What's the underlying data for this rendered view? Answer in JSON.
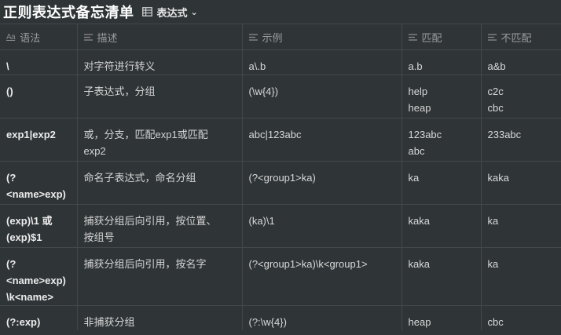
{
  "title": "正则表达式备忘清单",
  "view": {
    "label": "表达式",
    "icon": "table-icon",
    "chevron": "chevron-down-icon"
  },
  "columns": [
    {
      "label": "语法",
      "icon": "aa-title-icon"
    },
    {
      "label": "描述",
      "icon": "text-lines-icon"
    },
    {
      "label": "示例",
      "icon": "text-lines-icon"
    },
    {
      "label": "匹配",
      "icon": "text-lines-icon"
    },
    {
      "label": "不匹配",
      "icon": "text-lines-icon"
    }
  ],
  "rows": [
    {
      "syntax": [
        "\\"
      ],
      "desc": [
        "对字符进行转义"
      ],
      "example": [
        "a\\.b"
      ],
      "match": [
        "a.b"
      ],
      "nomatch": [
        "a&b"
      ]
    },
    {
      "syntax": [
        "()"
      ],
      "desc": [
        "子表达式，分组"
      ],
      "example": [
        "(\\w{4})"
      ],
      "match": [
        "help",
        "heap"
      ],
      "nomatch": [
        "c2c",
        "cbc"
      ]
    },
    {
      "syntax": [
        "exp1|exp2"
      ],
      "desc": [
        "或，分支，匹配exp1或匹配",
        "exp2"
      ],
      "example": [
        "abc|123abc"
      ],
      "match": [
        "123abc",
        "abc"
      ],
      "nomatch": [
        "233abc"
      ]
    },
    {
      "syntax": [
        "(?",
        "<name>exp)"
      ],
      "desc": [
        "命名子表达式，命名分组"
      ],
      "example": [
        "(?<group1>ka)"
      ],
      "match": [
        "ka"
      ],
      "nomatch": [
        "kaka"
      ]
    },
    {
      "syntax": [
        "(exp)\\1 或",
        "(exp)$1"
      ],
      "desc": [
        "捕获分组后向引用，按位置、",
        "按组号"
      ],
      "example": [
        "(ka)\\1"
      ],
      "match": [
        "kaka"
      ],
      "nomatch": [
        "ka"
      ]
    },
    {
      "syntax": [
        "(?",
        "<name>exp)",
        "\\k<name>"
      ],
      "desc": [
        "捕获分组后向引用，按名字"
      ],
      "example": [
        "(?<group1>ka)\\k<group1>"
      ],
      "match": [
        "kaka"
      ],
      "nomatch": [
        "ka"
      ]
    },
    {
      "syntax": [
        "(?:exp)"
      ],
      "desc": [
        "非捕获分组"
      ],
      "example": [
        "(?:\\w{4})"
      ],
      "match": [
        "heap"
      ],
      "nomatch": [
        "cbc"
      ]
    }
  ]
}
